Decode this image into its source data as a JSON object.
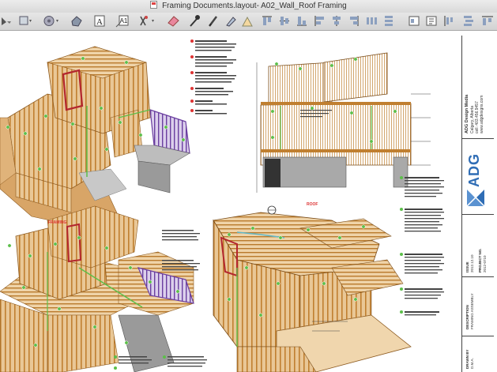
{
  "window": {
    "title": "Framing Documents.layout- A02_Wall_Roof Framing"
  },
  "toolbar": {
    "tools": [
      "select-tool-icon",
      "crop-tool-icon",
      "pie-tool-icon",
      "shape-tool-icon",
      "text-tool-icon",
      "label-tool-icon",
      "transform-tool-icon",
      "eraser-tool-icon",
      "eyedropper-tool-icon",
      "pencil-tool-icon",
      "paint-bucket-tool-icon",
      "offset-tool-icon",
      "align-top-icon",
      "align-middle-icon",
      "align-bottom-icon",
      "align-left-icon",
      "align-center-icon",
      "align-right-icon",
      "distribute-horizontal-icon",
      "distribute-vertical-icon"
    ]
  },
  "sheet": {
    "callouts": {
      "framing": "FRAMING",
      "roof": "ROOF"
    },
    "company": {
      "logo": "ADG",
      "name": "ADG Design Media",
      "city": "Calgary, Alberta",
      "phone": "cell: 403.456.9457",
      "web": "www.adgdesigns.com"
    },
    "fields": {
      "issue_label": "ISSUE",
      "issue_value": "2012.12.10",
      "project_label": "PROJECT NO.",
      "project_value": "2012-0710",
      "drawn_label": "DRAWN BY",
      "drawn_value": "D.M.A.",
      "description_label": "DESCRIPTION",
      "description_value": "FRAMING ASSEMBLY"
    },
    "notes_top": [
      "ROOF ASSEMBLY (R-1)",
      "PRE-ENGINEERED ROOF TRUSSES",
      "PRE-ENGINEERED FLOOR TRUSSES",
      "ROOF SHEATHING",
      "BEAM",
      "HEADER"
    ],
    "notes_right": [
      "WALL ASSEMBLY (E-1)",
      "FLOOR ASSEMBLY (F-1)",
      "WALL ASSEMBLY (E-2)",
      "WALL ASSEMBLY (E-3)",
      "WALL ASSEMBLY (BLANK)"
    ],
    "notes_bottom": [
      "ROUGH WALL ASSEMBLY",
      "STONE WALL ASSEMBLY (E-1 101)",
      "ROUGH WALL ASSEMBLY"
    ]
  },
  "colors": {
    "lumber": "#c9842f",
    "lumber_dark": "#8d5a1f",
    "purple": "#6b3fa0",
    "red": "#b3262e",
    "green": "#5cbf4a",
    "concrete": "#9a9a9a",
    "accent_blue": "#2f6db5"
  }
}
